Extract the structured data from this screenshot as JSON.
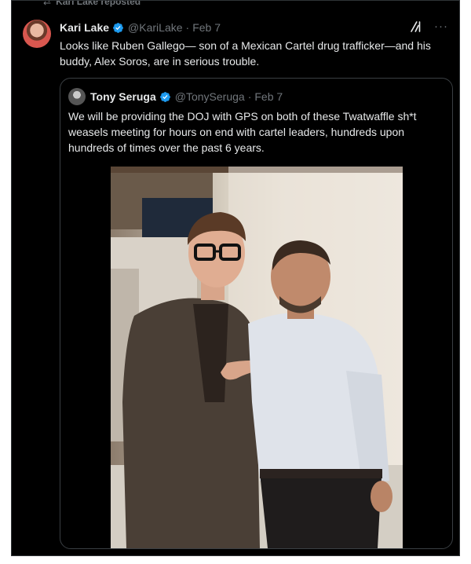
{
  "repost": {
    "label": "Kari Lake reposted"
  },
  "post": {
    "author_name": "Kari Lake",
    "handle": "@KariLake",
    "separator": "·",
    "date": "Feb 7",
    "text": "Looks like Ruben Gallego— son of a Mexican Cartel drug trafficker—and his buddy, Alex Soros, are in serious trouble.",
    "more_label": "···"
  },
  "quoted_post": {
    "author_name": "Tony Seruga",
    "handle": "@TonySeruga",
    "separator": "·",
    "date": "Feb 7",
    "text": "We will be providing the DOJ with GPS on both of these Twatwaffle sh*t weasels meeting for hours on end with cartel leaders, hundreds upon hundreds of times over the past 6 years."
  },
  "icons": {
    "verified": "verified-badge-icon",
    "grok": "grok-icon",
    "more": "more-options-icon",
    "repost": "repost-icon"
  },
  "colors": {
    "background": "#000000",
    "text_primary": "#e7e9ea",
    "text_secondary": "#71767b",
    "verified_blue": "#1d9bf0",
    "border": "#2f3336"
  }
}
